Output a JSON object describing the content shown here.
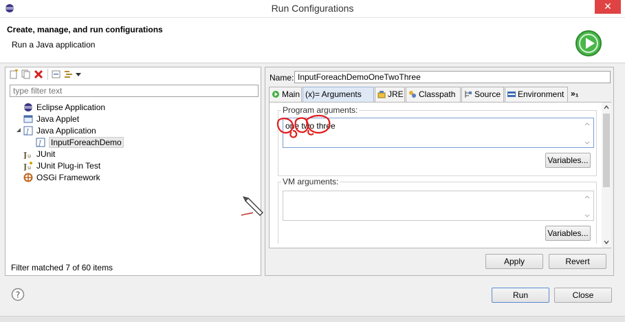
{
  "window": {
    "title": "Run Configurations",
    "close_glyph": "✕"
  },
  "header": {
    "title": "Create, manage, and run configurations",
    "subtitle": "Run a Java application",
    "run_icon": "run-green-circle-icon"
  },
  "left": {
    "toolbar_icons": [
      "new-config-icon",
      "duplicate-icon",
      "delete-icon",
      "collapse-all-icon",
      "filter-icon",
      "dropdown-arrow-icon"
    ],
    "filter_placeholder": "type filter text",
    "tree": [
      {
        "label": "Eclipse Application",
        "icon": "eclipse-icon",
        "level": 0
      },
      {
        "label": "Java Applet",
        "icon": "applet-icon",
        "level": 0
      },
      {
        "label": "Java Application",
        "icon": "java-app-icon",
        "level": 0,
        "expanded": true
      },
      {
        "label": "InputForeachDemo",
        "icon": "java-app-icon",
        "level": 1,
        "selected": true
      },
      {
        "label": "JUnit",
        "icon": "junit-icon",
        "level": 0
      },
      {
        "label": "JUnit Plug-in Test",
        "icon": "junit-plugin-icon",
        "level": 0
      },
      {
        "label": "OSGi Framework",
        "icon": "osgi-icon",
        "level": 0
      }
    ],
    "status": "Filter matched 7 of 60 items"
  },
  "right": {
    "name_label": "Name:",
    "name_value": "InputForeachDemoOneTwoThree",
    "tabs": [
      {
        "label": "Main",
        "icon": "main-tab-icon"
      },
      {
        "label": "(x)= Arguments",
        "icon": "arguments-tab-icon",
        "active": true
      },
      {
        "label": "JRE",
        "icon": "jre-tab-icon"
      },
      {
        "label": "Classpath",
        "icon": "classpath-tab-icon"
      },
      {
        "label": "Source",
        "icon": "source-tab-icon"
      },
      {
        "label": "Environment",
        "icon": "environment-tab-icon"
      },
      {
        "label": "»₁",
        "icon": "more-tabs-icon"
      }
    ],
    "program_args_label": "Program arguments:",
    "program_args_value": "one two three",
    "vm_args_label": "VM arguments:",
    "vm_args_value": "",
    "variables_label": "Variables...",
    "apply_label": "Apply",
    "revert_label": "Revert"
  },
  "bottom": {
    "help_glyph": "?",
    "run_label": "Run",
    "close_label": "Close"
  },
  "colors": {
    "accent_blue": "#7a9cd3",
    "close_red": "#e04343",
    "run_green": "#3fae3f",
    "annotation_red": "#e21b1b"
  }
}
